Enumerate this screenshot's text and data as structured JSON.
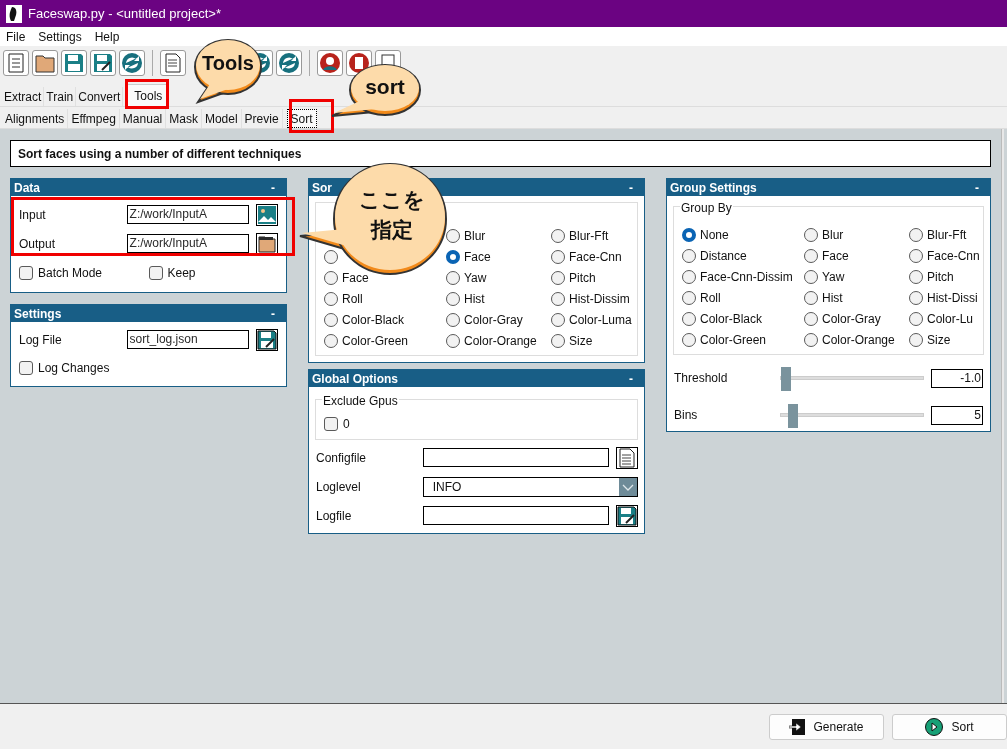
{
  "window": {
    "title": "Faceswap.py - <untitled project>*"
  },
  "menu": [
    "File",
    "Settings",
    "Help"
  ],
  "tabs": [
    {
      "label": "Extract",
      "selected": false
    },
    {
      "label": "Train",
      "selected": false
    },
    {
      "label": "Convert",
      "selected": false
    },
    {
      "label": "Tools",
      "selected": true
    }
  ],
  "subtabs": [
    {
      "label": "Alignments",
      "selected": false
    },
    {
      "label": "Effmpeg",
      "selected": false
    },
    {
      "label": "Manual",
      "selected": false
    },
    {
      "label": "Mask",
      "selected": false
    },
    {
      "label": "Model",
      "selected": false
    },
    {
      "label": "Previe",
      "selected": false
    },
    {
      "label": "Sort",
      "selected": true
    }
  ],
  "description": "Sort faces using a number of different techniques",
  "data_panel": {
    "title": "Data",
    "collapse": "-",
    "fields": [
      {
        "label": "Input",
        "value": "Z:/work/InputA",
        "kind": "image"
      },
      {
        "label": "Output",
        "value": "Z:/work/InputA",
        "kind": "folder"
      }
    ],
    "checkboxes": [
      {
        "label": "Batch Mode",
        "checked": false
      },
      {
        "label": "Keep",
        "checked": false
      }
    ]
  },
  "settings_panel": {
    "title": "Settings",
    "collapse": "-",
    "fields": [
      {
        "label": "Log File",
        "value": "sort_log.json",
        "kind": "save"
      }
    ],
    "checkboxes": [
      {
        "label": "Log Changes",
        "checked": false
      }
    ]
  },
  "sort_panel": {
    "title": "Sor",
    "collapse": "-",
    "options": [
      {
        "label": "Blur",
        "selected": false
      },
      {
        "label": "Blur-Fft",
        "selected": false
      },
      {
        "selected": false
      },
      {
        "label": "Face",
        "selected": true
      },
      {
        "label": "Face-Cnn",
        "selected": false
      },
      {
        "label": "Face",
        "selected": false
      },
      {
        "label": "Yaw",
        "selected": false
      },
      {
        "label": "Pitch",
        "selected": false
      },
      {
        "label": "Roll",
        "selected": false
      },
      {
        "label": "Hist",
        "selected": false
      },
      {
        "label": "Hist-Dissim",
        "selected": false
      },
      {
        "label": "Color-Black",
        "selected": false
      },
      {
        "label": "Color-Gray",
        "selected": false
      },
      {
        "label": "Color-Luma",
        "selected": false
      },
      {
        "label": "Color-Green",
        "selected": false
      },
      {
        "label": "Color-Orange",
        "selected": false
      },
      {
        "label": "Size",
        "selected": false
      }
    ]
  },
  "global_panel": {
    "title": "Global Options",
    "collapse": "-",
    "group": {
      "label": "Exclude Gpus",
      "checkboxes": [
        {
          "label": "0",
          "checked": false
        }
      ]
    },
    "fields": [
      {
        "label": "Configfile",
        "kind": "file"
      },
      {
        "label": "Loglevel",
        "kind": "select",
        "value": "INFO"
      },
      {
        "label": "Logfile",
        "kind": "save"
      }
    ]
  },
  "group_panel": {
    "title": "Group Settings",
    "collapse": "-",
    "group": {
      "label": "Group By",
      "options": [
        {
          "label": "None",
          "selected": true
        },
        {
          "label": "Blur",
          "selected": false
        },
        {
          "label": "Blur-Fft",
          "selected": false
        },
        {
          "label": "Distance",
          "selected": false
        },
        {
          "label": "Face",
          "selected": false
        },
        {
          "label": "Face-Cnn",
          "selected": false
        },
        {
          "label": "Face-Cnn-Dissim",
          "selected": false
        },
        {
          "label": "Yaw",
          "selected": false
        },
        {
          "label": "Pitch",
          "selected": false
        },
        {
          "label": "Roll",
          "selected": false
        },
        {
          "label": "Hist",
          "selected": false
        },
        {
          "label": "Hist-Dissi",
          "selected": false
        },
        {
          "label": "Color-Black",
          "selected": false
        },
        {
          "label": "Color-Gray",
          "selected": false
        },
        {
          "label": "Color-Lu",
          "selected": false
        },
        {
          "label": "Color-Green",
          "selected": false
        },
        {
          "label": "Color-Orange",
          "selected": false
        },
        {
          "label": "Size",
          "selected": false
        }
      ]
    },
    "sliders": [
      {
        "label": "Threshold",
        "level": 0,
        "value": "-1.0"
      },
      {
        "label": "Bins",
        "level": 0.05,
        "value": "5"
      }
    ]
  },
  "buttons": [
    {
      "label": "Generate",
      "kind": "generate"
    },
    {
      "label": "Sort",
      "kind": "run"
    }
  ],
  "callouts": [
    {
      "lines": [
        "Tools"
      ]
    },
    {
      "lines": [
        "sort"
      ]
    },
    {
      "lines": [
        "ここを",
        "指定"
      ]
    }
  ]
}
